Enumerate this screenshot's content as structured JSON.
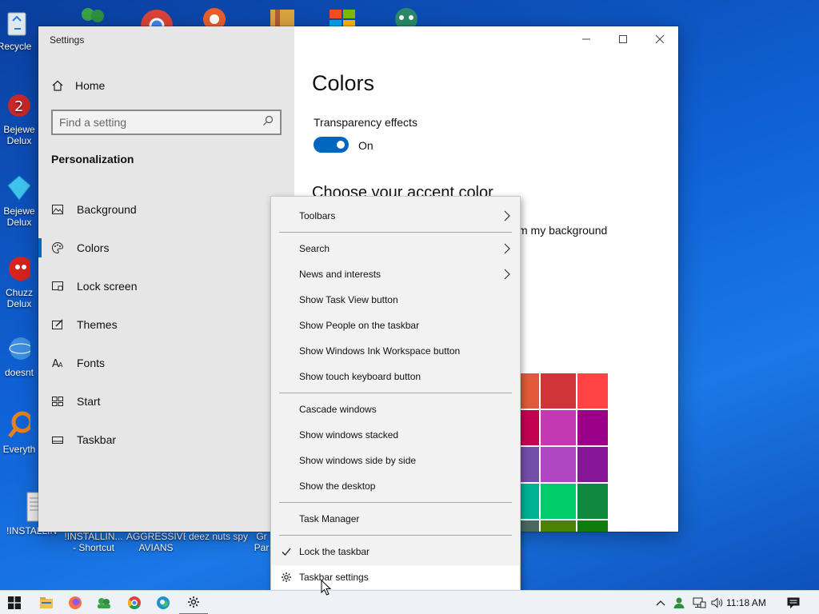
{
  "desktop": {
    "icons": [
      {
        "label": "Recycle"
      },
      {
        "label": "Bejewe Delux"
      },
      {
        "label": "Bejewe Delux"
      },
      {
        "label": "Chuzz Delux"
      },
      {
        "label": "doesnt"
      },
      {
        "label": "Everyth"
      },
      {
        "label": "!INSTALLIN..."
      },
      {
        "label": "!INSTALLIN... - Shortcut"
      },
      {
        "label": "AGGRESSIVE AVIANS"
      },
      {
        "label": "deez nuts spy"
      },
      {
        "label": "Gr Par"
      }
    ]
  },
  "settings": {
    "window_title": "Settings",
    "home_label": "Home",
    "search_placeholder": "Find a setting",
    "section_heading": "Personalization",
    "nav_items": [
      {
        "label": "Background",
        "icon": "picture-icon"
      },
      {
        "label": "Colors",
        "icon": "palette-icon",
        "selected": true
      },
      {
        "label": "Lock screen",
        "icon": "lock-screen-icon"
      },
      {
        "label": "Themes",
        "icon": "brush-icon"
      },
      {
        "label": "Fonts",
        "icon": "font-icon"
      },
      {
        "label": "Start",
        "icon": "start-tiles-icon"
      },
      {
        "label": "Taskbar",
        "icon": "taskbar-icon"
      }
    ],
    "page_title": "Colors",
    "transparency_label": "Transparency effects",
    "transparency_state": "On",
    "accent_heading": "Choose your accent color",
    "auto_pick_text": "m my background",
    "accent_swatches": [
      [
        "#e05a3a",
        "#d13438",
        "#ff4343"
      ],
      [
        "#c30052",
        "#c239b3",
        "#9a0089"
      ],
      [
        "#744da9",
        "#b146c2",
        "#881798"
      ],
      [
        "#00b294",
        "#00cc6a",
        "#10893e"
      ],
      [
        "#486860",
        "#498205",
        "#107c10"
      ]
    ]
  },
  "context_menu": {
    "items": [
      {
        "label": "Toolbars",
        "submenu": true
      },
      {
        "label": "Search",
        "submenu": true
      },
      {
        "label": "News and interests",
        "submenu": true
      },
      {
        "label": "Show Task View button"
      },
      {
        "label": "Show People on the taskbar"
      },
      {
        "label": "Show Windows Ink Workspace button"
      },
      {
        "label": "Show touch keyboard button"
      },
      {
        "label": "Cascade windows"
      },
      {
        "label": "Show windows stacked"
      },
      {
        "label": "Show windows side by side"
      },
      {
        "label": "Show the desktop"
      },
      {
        "label": "Task Manager"
      },
      {
        "label": "Lock the taskbar",
        "checked": true
      },
      {
        "label": "Taskbar settings",
        "icon": "gear-icon",
        "hovered": true
      }
    ]
  },
  "taskbar": {
    "apps": [
      "start-icon",
      "file-explorer-icon",
      "firefox-icon",
      "people-icon",
      "chrome-icon",
      "edge-icon",
      "settings-gear-icon"
    ],
    "tray": [
      "chevron-up-icon",
      "people-tray-icon",
      "network-icon",
      "volume-icon"
    ],
    "clock": "11:18 AM",
    "notification_icon": "action-center-icon"
  },
  "colors": {
    "accent": "#0067c0",
    "sidebar_bg": "#e6e6e6",
    "menu_bg": "#f2f2f2"
  }
}
